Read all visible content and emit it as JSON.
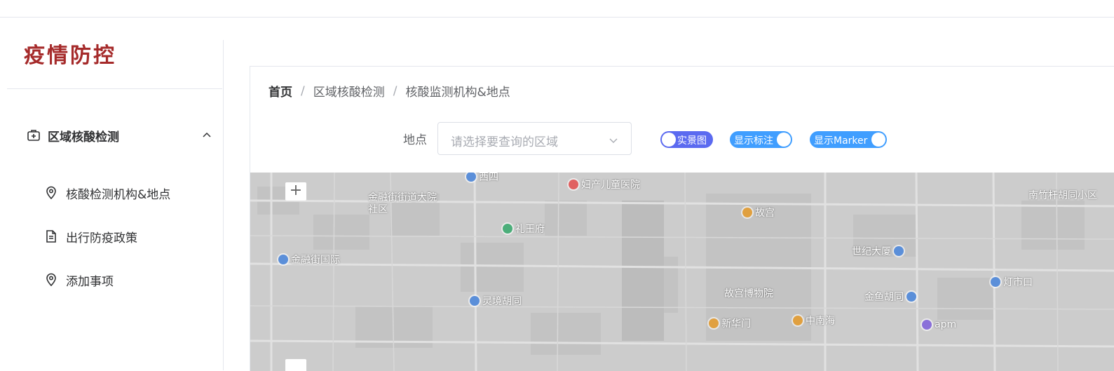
{
  "app": {
    "logo": "疫情防控"
  },
  "sidebar": {
    "group": {
      "label": "区域核酸检测",
      "icon": "medical-kit-icon",
      "expanded": true
    },
    "items": [
      {
        "label": "核酸检测机构&地点",
        "icon": "location-pin-icon"
      },
      {
        "label": "出行防疫政策",
        "icon": "document-icon"
      },
      {
        "label": "添加事项",
        "icon": "location-pin-icon"
      }
    ]
  },
  "breadcrumb": [
    "首页",
    "区域核酸检测",
    "核酸监测机构&地点"
  ],
  "filter": {
    "label": "地点",
    "placeholder": "请选择要查询的区域"
  },
  "switches": [
    {
      "label": "实景图",
      "on": false,
      "color": "#5b6af0"
    },
    {
      "label": "显示标注",
      "on": true,
      "color": "#409eff"
    },
    {
      "label": "显示Marker",
      "on": true,
      "color": "#409eff"
    }
  ],
  "map": {
    "zoom_in": "+",
    "pois": [
      {
        "label": "西四",
        "color": "#5b8fd9"
      },
      {
        "label": "妇产儿童医院",
        "color": "#e06060"
      },
      {
        "label": "金融街街道大院社区",
        "color": "#e06060"
      },
      {
        "label": "礼王府",
        "color": "#4cae7a"
      },
      {
        "label": "故宫",
        "color": "#e0a040"
      },
      {
        "label": "南竹杆胡同小区",
        "color": "#888888"
      },
      {
        "label": "金融街国际",
        "color": "#5b8fd9"
      },
      {
        "label": "世纪大厦",
        "color": "#5b8fd9"
      },
      {
        "label": "灵境胡同",
        "color": "#5b8fd9"
      },
      {
        "label": "故宫博物院",
        "color": "#e0a040"
      },
      {
        "label": "金鱼胡同",
        "color": "#5b8fd9"
      },
      {
        "label": "灯市口",
        "color": "#5b8fd9"
      },
      {
        "label": "新华门",
        "color": "#e0a040"
      },
      {
        "label": "中南海",
        "color": "#e0a040"
      },
      {
        "label": "apm",
        "color": "#8a6fd9"
      }
    ]
  }
}
